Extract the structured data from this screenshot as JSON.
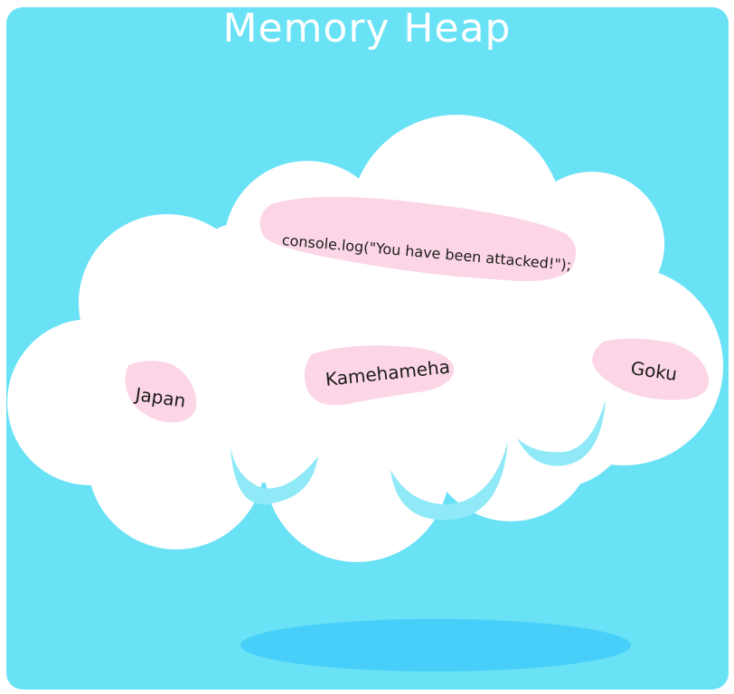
{
  "title": "Memory Heap",
  "colors": {
    "background": "#6ae2f6",
    "cloud": "#ffffff",
    "cloud_shade": "#8fe9f7",
    "blob": "#fcd6e6",
    "shadow": "#47cff9",
    "title_text": "#ffffff"
  },
  "heap_items": [
    {
      "label": "console.log(\"You have been attacked!\");"
    },
    {
      "label": "Japan"
    },
    {
      "label": "Kamehameha"
    },
    {
      "label": "Goku"
    }
  ]
}
